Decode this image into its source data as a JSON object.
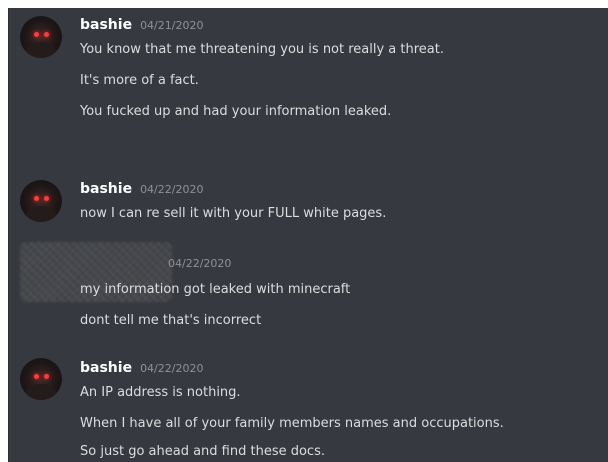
{
  "groups": [
    {
      "username": "bashie",
      "timestamp": "04/21/2020",
      "lines": [
        "You know that me threatening you is not really a threat.",
        "It's more of a fact.",
        "You fucked up and had your information leaked."
      ]
    },
    {
      "username": "bashie",
      "timestamp": "04/22/2020",
      "lines": [
        "now I can re sell it with your FULL white pages."
      ]
    },
    {
      "username": "",
      "timestamp": "04/22/2020",
      "lines": [
        "my information got leaked with minecraft",
        "dont tell me that's incorrect"
      ]
    },
    {
      "username": "bashie",
      "timestamp": "04/22/2020",
      "lines": [
        "An IP address is nothing.",
        "When I have all of your family members names and occupations.",
        "So just go ahead and find these docs."
      ]
    }
  ]
}
